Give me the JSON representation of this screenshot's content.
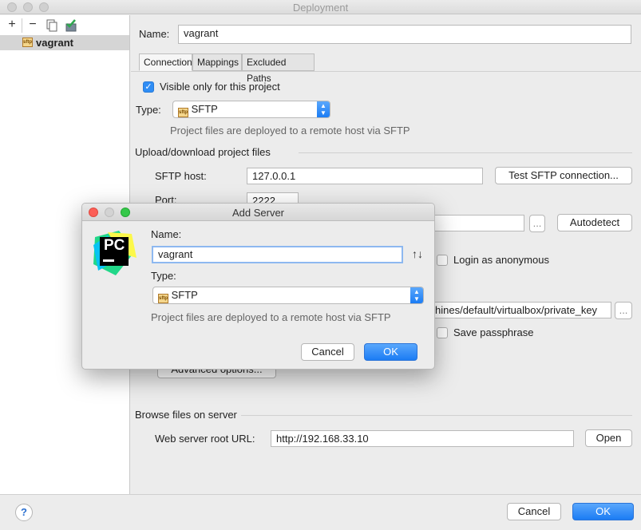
{
  "window": {
    "title": "Deployment"
  },
  "sidebar": {
    "toolbar": {
      "add_label": "+",
      "remove_label": "−"
    },
    "items": [
      {
        "label": "vagrant",
        "icon": "sftp-icon",
        "icon_text": "sftp"
      }
    ]
  },
  "form": {
    "name_label": "Name:",
    "name_value": "vagrant",
    "tabs": [
      {
        "label": "Connection",
        "active": true
      },
      {
        "label": "Mappings",
        "active": false
      },
      {
        "label": "Excluded Paths",
        "active": false
      }
    ],
    "visible_only_label": "Visible only for this project",
    "type_label": "Type:",
    "type_value": "SFTP",
    "type_hint": "Project files are deployed to a remote host via SFTP",
    "upload_section": "Upload/download project files",
    "sftp_host_label": "SFTP host:",
    "sftp_host_value": "127.0.0.1",
    "test_button": "Test SFTP connection...",
    "port_label": "Port:",
    "port_value": "2222",
    "root_path_browse": "...",
    "autodetect_button": "Autodetect",
    "login_anonymous_label": "Login as anonymous",
    "key_path_value": "hines/default/virtualbox/private_key",
    "key_browse": "...",
    "save_passphrase_label": "Save passphrase",
    "advanced_button": "Advanced options...",
    "browse_section": "Browse files on server",
    "web_root_label": "Web server root URL:",
    "web_root_value": "http://192.168.33.10",
    "open_button": "Open"
  },
  "footer": {
    "help_label": "?",
    "cancel_label": "Cancel",
    "ok_label": "OK"
  },
  "dialog": {
    "title": "Add Server",
    "logo_text": "PC",
    "name_label": "Name:",
    "name_value": "vagrant",
    "sort_icon": "↑↓",
    "type_label": "Type:",
    "type_value": "SFTP",
    "type_hint": "Project files are deployed to a remote host via SFTP",
    "cancel_label": "Cancel",
    "ok_label": "OK"
  },
  "colors": {
    "accent": "#1b7cf4",
    "selection": "#d5d5d5"
  }
}
